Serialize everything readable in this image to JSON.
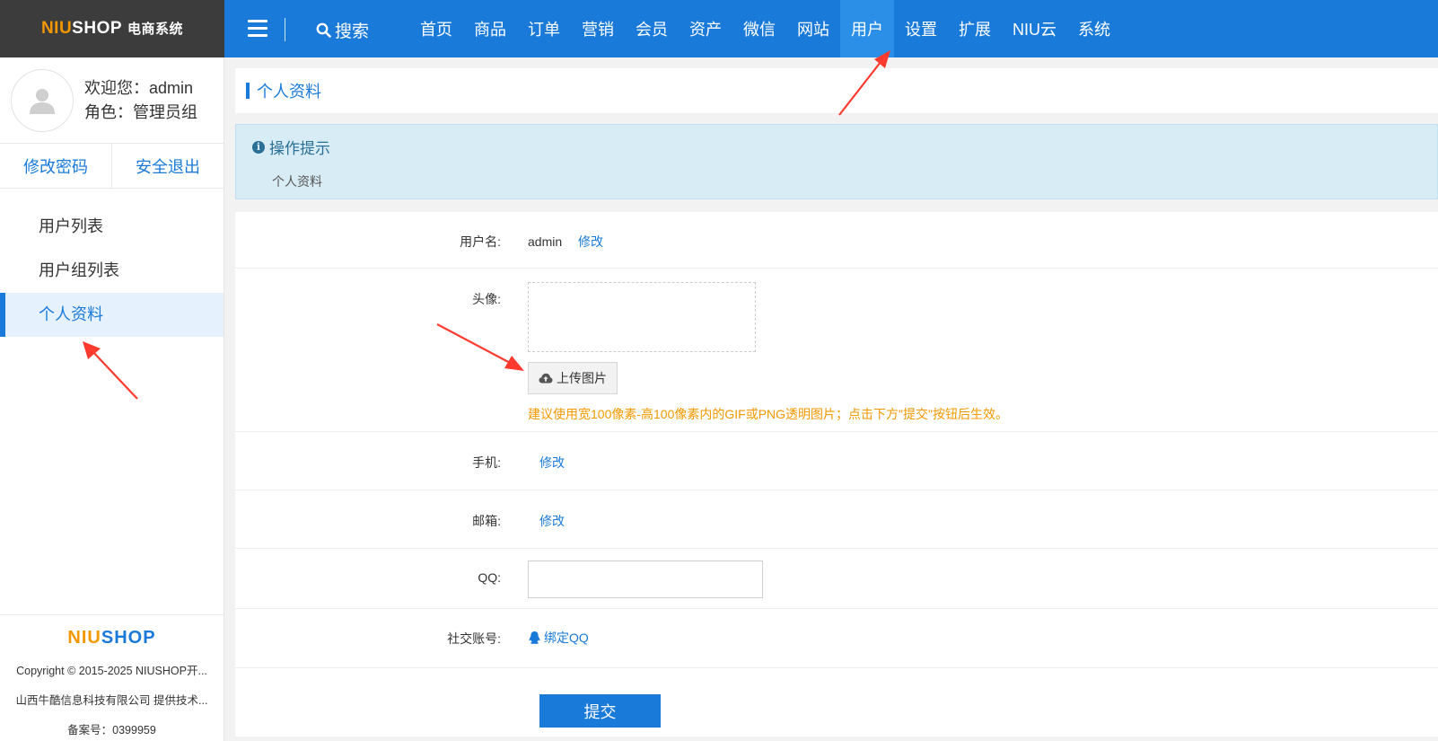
{
  "brand": {
    "logo_a": "NIU",
    "logo_b": "SHOP",
    "logo_suffix": "电商系统"
  },
  "topbar": {
    "search_label": "搜索",
    "nav": [
      "首页",
      "商品",
      "订单",
      "营销",
      "会员",
      "资产",
      "微信",
      "网站",
      "用户",
      "设置",
      "扩展",
      "NIU云",
      "系统"
    ],
    "active": "用户"
  },
  "sidebar": {
    "welcome": "欢迎您：admin",
    "role": "角色：管理员组",
    "change_password": "修改密码",
    "logout": "安全退出",
    "menu": [
      "用户列表",
      "用户组列表",
      "个人资料"
    ],
    "active_menu": "个人资料",
    "footer_logo_a": "NIU",
    "footer_logo_b": "SHOP",
    "copyright": "Copyright © 2015-2025 NIUSHOP开...",
    "provider": "山西牛酷信息科技有限公司 提供技术...",
    "icp": "备案号：0399959"
  },
  "main": {
    "page_title": "个人资料",
    "tips_title": "操作提示",
    "tips_body": "个人资料",
    "form": {
      "username_label": "用户名:",
      "username_value": "admin",
      "edit_label": "修改",
      "avatar_label": "头像:",
      "upload_label": "上传图片",
      "avatar_hint": "建议使用宽100像素-高100像素内的GIF或PNG透明图片；点击下方\"提交\"按钮后生效。",
      "phone_label": "手机:",
      "email_label": "邮箱:",
      "qq_label": "QQ:",
      "qq_value": "",
      "social_label": "社交账号:",
      "bind_qq": "绑定QQ",
      "submit_label": "提交"
    }
  },
  "colors": {
    "primary": "#1a7ad9",
    "accent": "#f39800",
    "arrow": "#ff3b30"
  }
}
